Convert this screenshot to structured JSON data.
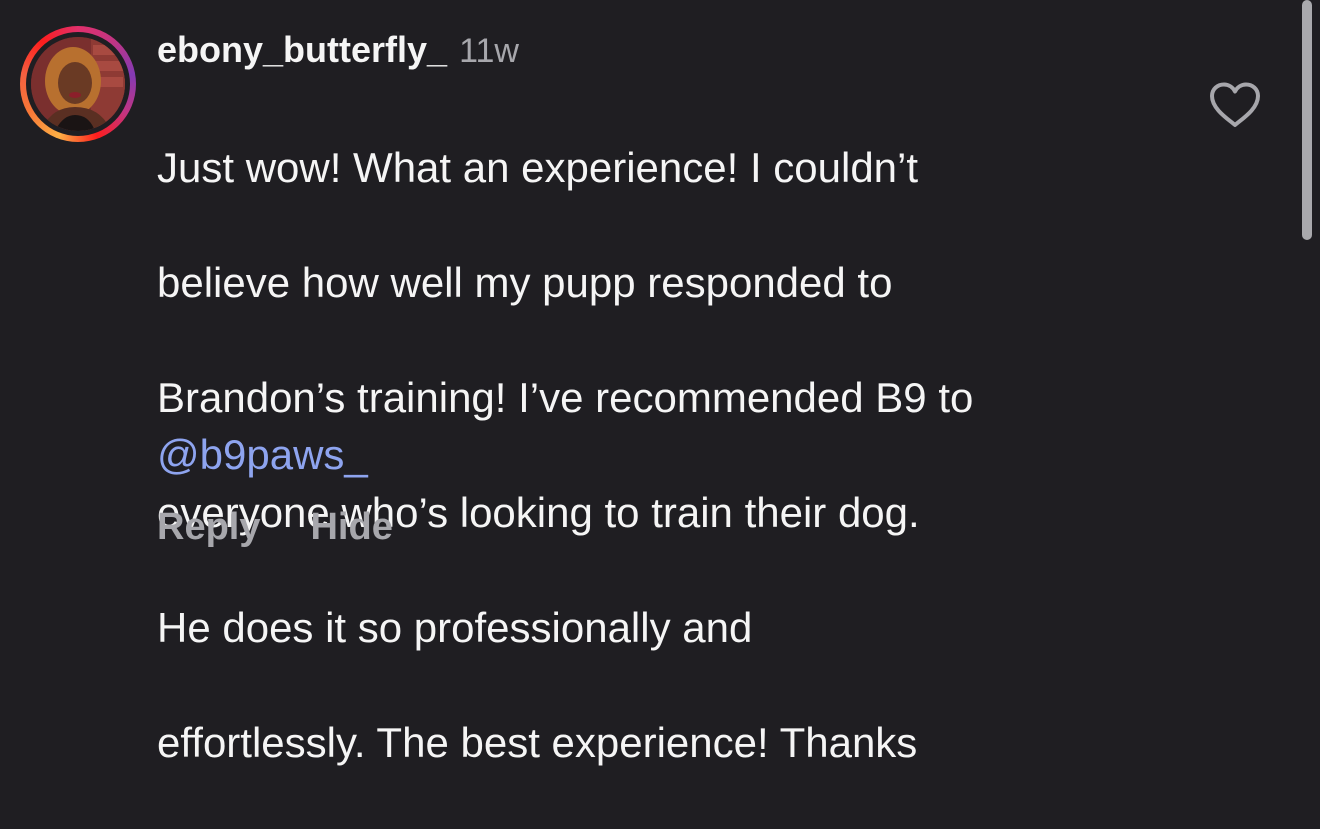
{
  "comment": {
    "username": "ebony_butterfly_",
    "timestamp": "11w",
    "text_lines": [
      "Just wow! What an experience! I couldn’t",
      "believe how well my pupp responded to",
      "Brandon’s training! I’ve recommended B9 to",
      "everyone who’s looking to train their dog.",
      "He does it so professionally and",
      "effortlessly. The best experience! Thanks"
    ],
    "mention": "@b9paws_",
    "like_icon": "heart-outline-icon"
  },
  "actions": {
    "reply_label": "Reply",
    "hide_label": "Hide"
  },
  "colors": {
    "background": "#1f1e22",
    "text": "#f5f5f5",
    "muted": "#a7a7ac",
    "mention": "#8ea4ef"
  }
}
